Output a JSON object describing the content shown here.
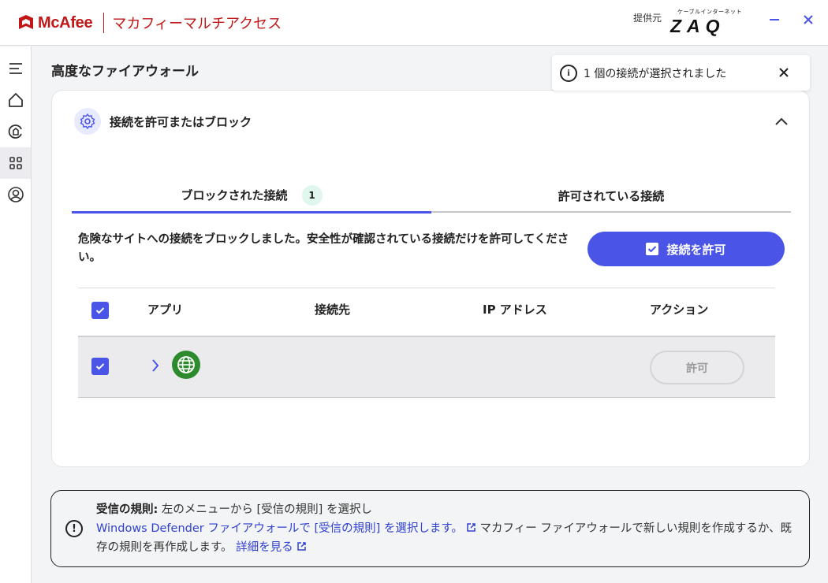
{
  "titlebar": {
    "brand": "McAfee",
    "app_name": "マカフィーマルチアクセス",
    "provider_label": "提供元",
    "partner_sub": "ケーブルインターネット",
    "partner_logo": "ZAQ",
    "minimize_icon": "minimize-icon",
    "close_icon": "close-icon"
  },
  "rail": {
    "items": [
      "menu-icon",
      "home-icon",
      "protection-icon",
      "apps-grid-icon",
      "account-icon"
    ]
  },
  "page": {
    "title": "高度なファイアウォール"
  },
  "toast": {
    "text": "1 個の接続が選択されました"
  },
  "card": {
    "title": "接続を許可またはブロック",
    "tabs": [
      {
        "label": "ブロックされた接続",
        "badge": "1"
      },
      {
        "label": "許可されている接続"
      }
    ],
    "description": "危険なサイトへの接続をブロックしました。安全性が確認されている接続だけを許可してください。",
    "allow_button": "接続を許可",
    "table": {
      "headers": [
        "アプリ",
        "接続先",
        "IP アドレス",
        "アクション"
      ],
      "rows": [
        {
          "app_icon": "globe-icon",
          "destination": "",
          "ip": "",
          "action": "許可",
          "checked": true
        }
      ]
    }
  },
  "info": {
    "bold_label": "受信の規則:",
    "text_1": " 左のメニューから [受信の規則] を選択し",
    "link_1": "Windows Defender ファイアウォールで [受信の規則] を選択します。",
    "text_2": " マカフィー ファイアウォールで新しい規則を作成するか、既存の規則を再作成します。",
    "link_2": "詳細を見る"
  },
  "colors": {
    "brand_red": "#c01818",
    "accent": "#4a55e8",
    "badge_bg": "#dff7ec"
  }
}
